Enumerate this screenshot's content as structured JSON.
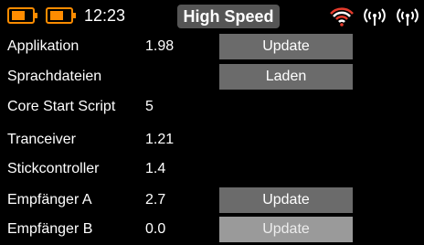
{
  "status": {
    "time": "12:23",
    "mode": "High Speed",
    "accent_color": "#ff8c00",
    "icons": [
      "battery-icon",
      "battery-icon",
      "wifi-icon",
      "antenna-icon",
      "antenna-icon"
    ]
  },
  "rows": [
    {
      "label": "Applikation",
      "value": "1.98",
      "button": "Update"
    },
    {
      "label": "Sprachdateien",
      "value": "",
      "button": "Laden"
    },
    {
      "label": "Core Start Script",
      "value": "5"
    },
    {
      "label": "Tranceiver",
      "value": "1.21"
    },
    {
      "label": "Stickcontroller",
      "value": "1.4"
    },
    {
      "label": "Empfänger A",
      "value": "2.7",
      "button": "Update"
    },
    {
      "label": "Empfänger B",
      "value": "0.0",
      "button": "Update"
    }
  ]
}
